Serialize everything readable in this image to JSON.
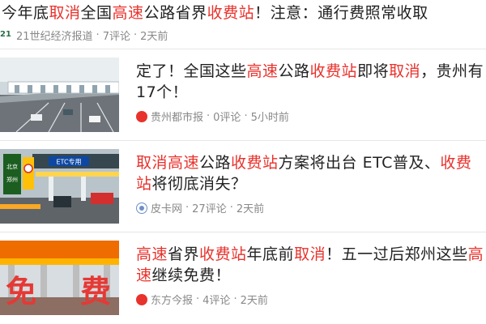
{
  "items": [
    {
      "title_parts": [
        "今年底",
        "取消",
        "全国",
        "高速",
        "公路省界",
        "收费站",
        "！注意：通行费照常收取"
      ],
      "source_logo": "21",
      "source": "21世纪经济报道",
      "comments": "7评论",
      "time": "2天前"
    },
    {
      "title_parts": [
        "定了！全国这些",
        "高速",
        "公路",
        "收费站",
        "即将",
        "取消",
        "，贵州有17个！"
      ],
      "source": "贵州都市报",
      "comments": "0评论",
      "time": "5小时前",
      "thumb_icon": "highway-toll-plaza-image"
    },
    {
      "title_parts": [
        "",
        "取消高速",
        "公路",
        "收费站",
        "方案将出台 ETC普及、",
        "收费站",
        "将彻底消失？"
      ],
      "source": "皮卡网",
      "comments": "27评论",
      "time": "2天前",
      "thumb_icon": "etc-toll-gate-image",
      "thumb_signs": [
        "北京",
        "郑州",
        "ETC专用"
      ]
    },
    {
      "title_parts": [
        "",
        "高速",
        "省界",
        "收费站",
        "年底前",
        "取消",
        "！五一过后郑州这些",
        "高速",
        "继续免费！"
      ],
      "source": "东方今报",
      "comments": "4评论",
      "time": "2天前",
      "thumb_icon": "free-toll-banner-image",
      "thumb_banner": [
        "免",
        "费"
      ]
    }
  ],
  "colors": {
    "highlight": "#e8322c",
    "meta": "#888888",
    "text": "#222222"
  }
}
